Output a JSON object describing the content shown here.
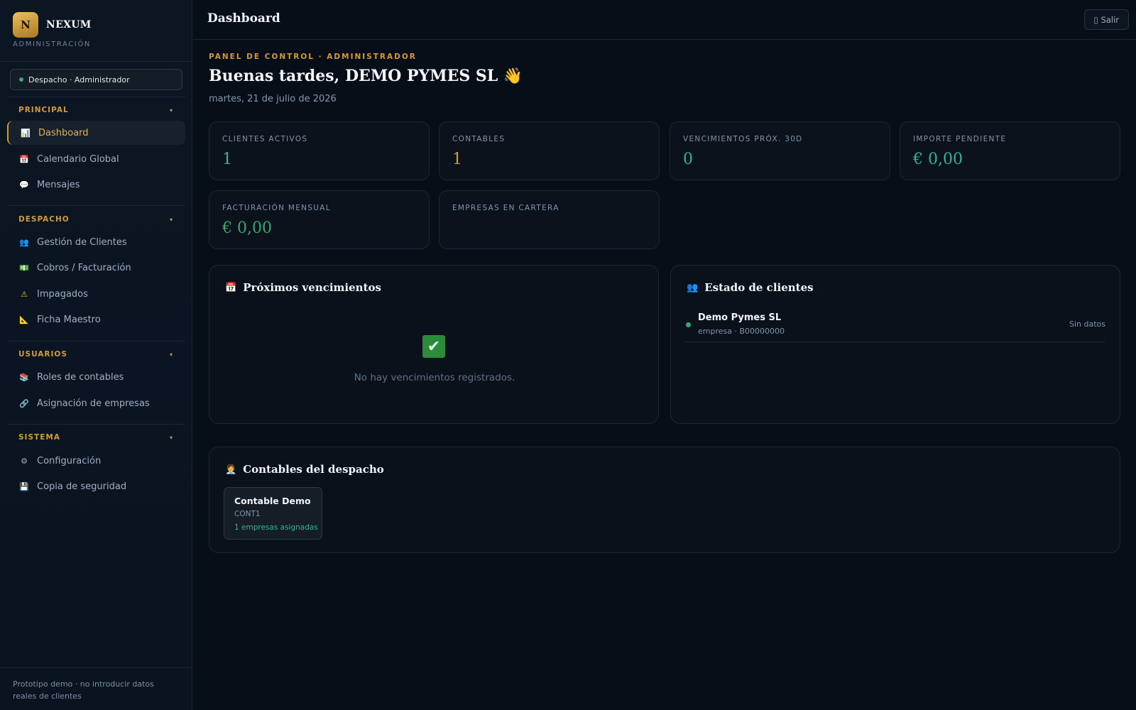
{
  "brand": {
    "logo_letter": "N",
    "name": "NEXUM",
    "subtitle": "ADMINISTRACIÓN"
  },
  "role_badge": "Despacho · Administrador",
  "sidebar": {
    "sections": [
      {
        "title": "PRINCIPAL",
        "items": [
          {
            "label": "Dashboard",
            "icon": "bar-chart-icon",
            "glyph": "📊",
            "active": true
          },
          {
            "label": "Calendario Global",
            "icon": "calendar-icon",
            "glyph": "📅"
          },
          {
            "label": "Mensajes",
            "icon": "chat-bubble-icon",
            "glyph": "💬"
          }
        ]
      },
      {
        "title": "DESPACHO",
        "items": [
          {
            "label": "Gestión de Clientes",
            "icon": "users-icon",
            "glyph": "👥"
          },
          {
            "label": "Cobros / Facturación",
            "icon": "banknote-icon",
            "glyph": "💵"
          },
          {
            "label": "Impagados",
            "icon": "warning-icon",
            "glyph": "⚠"
          },
          {
            "label": "Ficha Maestro",
            "icon": "triangle-ruler-icon",
            "glyph": "📐"
          }
        ]
      },
      {
        "title": "USUARIOS",
        "items": [
          {
            "label": "Roles de contables",
            "icon": "books-icon",
            "glyph": "📚"
          },
          {
            "label": "Asignación de empresas",
            "icon": "link-icon",
            "glyph": "🔗"
          }
        ]
      },
      {
        "title": "SISTEMA",
        "items": [
          {
            "label": "Configuración",
            "icon": "gear-icon",
            "glyph": "⚙"
          },
          {
            "label": "Copia de seguridad",
            "icon": "floppy-disk-icon",
            "glyph": "💾"
          }
        ]
      }
    ],
    "caret": "▾",
    "footer": "Prototipo demo · no introducir datos reales de clientes"
  },
  "topbar": {
    "title": "Dashboard",
    "logout_label": "▯ Salir"
  },
  "header": {
    "eyebrow": "PANEL DE CONTROL · ADMINISTRADOR",
    "greeting": "Buenas tardes, DEMO PYMES SL 👋",
    "date": "martes, 21 de julio de 2026"
  },
  "stats": [
    {
      "label": "CLIENTES ACTIVOS",
      "value": "1",
      "color": "#2fb39a"
    },
    {
      "label": "CONTABLES",
      "value": "1",
      "color": "#d39a35"
    },
    {
      "label": "VENCIMIENTOS PRÓX. 30D",
      "value": "0",
      "color": "#2fb39a"
    },
    {
      "label": "IMPORTE PENDIENTE",
      "value": "€ 0,00",
      "color": "#2fb39a"
    },
    {
      "label": "FACTURACIÓN MENSUAL",
      "value": "€ 0,00",
      "color": "#3aa76d"
    },
    {
      "label": "EMPRESAS EN CARTERA",
      "value": "",
      "color": "#2fb39a"
    }
  ],
  "deadlines_panel": {
    "icon_glyph": "📅",
    "title": "Próximos vencimientos",
    "empty_glyph": "✔",
    "empty_text": "No hay vencimientos registrados."
  },
  "clients_panel": {
    "icon_glyph": "👥",
    "title": "Estado de clientes",
    "clients": [
      {
        "name": "Demo Pymes SL",
        "sub": "empresa · B00000000",
        "status": "Sin datos"
      }
    ]
  },
  "accountants_panel": {
    "icon_glyph": "🧑‍💼",
    "title": "Contables del despacho",
    "accountants": [
      {
        "name": "Contable Demo",
        "code": "CONT1",
        "assigned": "1 empresas asignadas"
      }
    ]
  },
  "colors": {
    "accent_gold": "#d39a35",
    "accent_teal": "#2fb39a",
    "accent_green": "#3aa76d",
    "background": "#080e18"
  }
}
